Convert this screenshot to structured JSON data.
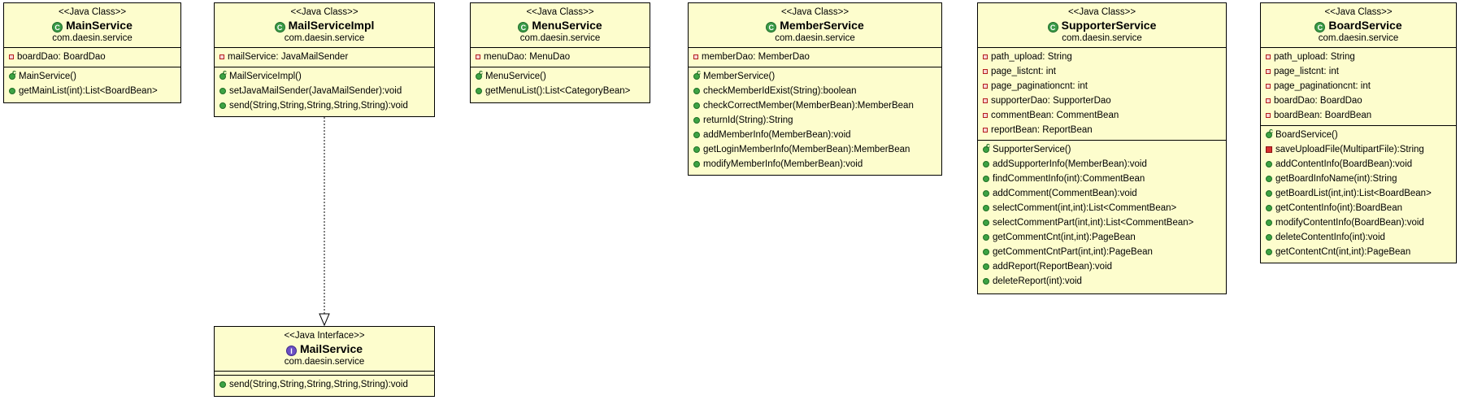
{
  "classes": {
    "mainService": {
      "stereotype": "<<Java Class>>",
      "name": "MainService",
      "package": "com.daesin.service",
      "fields": [
        "boardDao: BoardDao"
      ],
      "methods": [
        "MainService()",
        "getMainList(int):List<BoardBean>"
      ]
    },
    "mailServiceImpl": {
      "stereotype": "<<Java Class>>",
      "name": "MailServiceImpl",
      "package": "com.daesin.service",
      "fields": [
        "mailService: JavaMailSender"
      ],
      "methods": [
        "MailServiceImpl()",
        "setJavaMailSender(JavaMailSender):void",
        "send(String,String,String,String,String):void"
      ]
    },
    "menuService": {
      "stereotype": "<<Java Class>>",
      "name": "MenuService",
      "package": "com.daesin.service",
      "fields": [
        "menuDao: MenuDao"
      ],
      "methods": [
        "MenuService()",
        "getMenuList():List<CategoryBean>"
      ]
    },
    "memberService": {
      "stereotype": "<<Java Class>>",
      "name": "MemberService",
      "package": "com.daesin.service",
      "fields": [
        "memberDao: MemberDao"
      ],
      "methods": [
        "MemberService()",
        "checkMemberIdExist(String):boolean",
        "checkCorrectMember(MemberBean):MemberBean",
        "returnId(String):String",
        "addMemberInfo(MemberBean):void",
        "getLoginMemberInfo(MemberBean):MemberBean",
        "modifyMemberInfo(MemberBean):void"
      ]
    },
    "supporterService": {
      "stereotype": "<<Java Class>>",
      "name": "SupporterService",
      "package": "com.daesin.service",
      "fields": [
        "path_upload: String",
        "page_listcnt: int",
        "page_paginationcnt: int",
        "supporterDao: SupporterDao",
        "commentBean: CommentBean",
        "reportBean: ReportBean"
      ],
      "methods": [
        "SupporterService()",
        "addSupporterInfo(MemberBean):void",
        "findCommentInfo(int):CommentBean",
        "addComment(CommentBean):void",
        "selectComment(int,int):List<CommentBean>",
        "selectCommentPart(int,int):List<CommentBean>",
        "getCommentCnt(int,int):PageBean",
        "getCommentCntPart(int,int):PageBean",
        "addReport(ReportBean):void",
        "deleteReport(int):void"
      ]
    },
    "boardService": {
      "stereotype": "<<Java Class>>",
      "name": "BoardService",
      "package": "com.daesin.service",
      "fields": [
        "path_upload: String",
        "page_listcnt: int",
        "page_paginationcnt: int",
        "boardDao: BoardDao",
        "boardBean: BoardBean"
      ],
      "methods": [
        "BoardService()",
        "saveUploadFile(MultipartFile):String",
        "addContentInfo(BoardBean):void",
        "getBoardInfoName(int):String",
        "getBoardList(int,int):List<BoardBean>",
        "getContentInfo(int):BoardBean",
        "modifyContentInfo(BoardBean):void",
        "deleteContentInfo(int):void",
        "getContentCnt(int,int):PageBean"
      ]
    },
    "mailService": {
      "stereotype": "<<Java Interface>>",
      "name": "MailService",
      "package": "com.daesin.service",
      "fields": [],
      "methods": [
        "send(String,String,String,String,String):void"
      ]
    }
  },
  "colors": {
    "box_fill": "#fdfdcd",
    "border": "#000000",
    "class_icon": "#3b9b47",
    "interface_icon": "#6b4fc4"
  }
}
